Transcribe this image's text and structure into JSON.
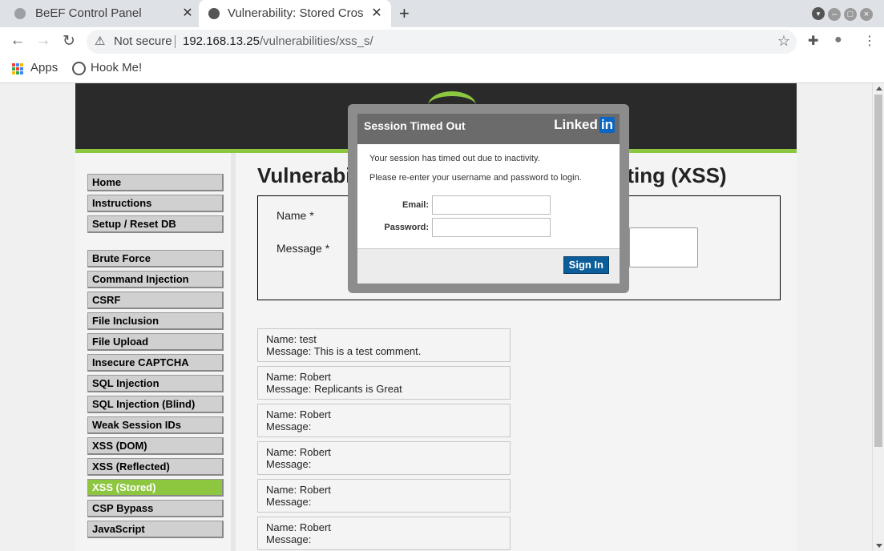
{
  "browser": {
    "tabs": [
      {
        "title": "BeEF Control Panel",
        "close": "✕"
      },
      {
        "title": "Vulnerability: Stored Cross Site Scripting (XSS) :: Damn Vulnerable Web Application (DVWA)",
        "close": "✕"
      }
    ],
    "new_tab": "+",
    "address": {
      "security": "Not secure",
      "host": "192.168.13.25",
      "path": "/vulnerabilities/xss_s/"
    },
    "bookmarks": [
      {
        "label": "Apps",
        "icon": "apps-grid-icon"
      },
      {
        "label": "Hook Me!",
        "icon": "globe-icon"
      }
    ],
    "icons": {
      "back": "←",
      "forward": "→",
      "reload": "↻",
      "warning": "⚠",
      "star": "☆",
      "extensions": "✚",
      "profile": "●",
      "menu": "⋮",
      "tab_menu": "▾"
    }
  },
  "dvwa": {
    "menu": [
      {
        "label": "Home"
      },
      {
        "label": "Instructions"
      },
      {
        "label": "Setup / Reset DB"
      },
      {
        "label": "Brute Force"
      },
      {
        "label": "Command Injection"
      },
      {
        "label": "CSRF"
      },
      {
        "label": "File Inclusion"
      },
      {
        "label": "File Upload"
      },
      {
        "label": "Insecure CAPTCHA"
      },
      {
        "label": "SQL Injection"
      },
      {
        "label": "SQL Injection (Blind)"
      },
      {
        "label": "Weak Session IDs"
      },
      {
        "label": "XSS (DOM)"
      },
      {
        "label": "XSS (Reflected)"
      },
      {
        "label": "XSS (Stored)",
        "active": true
      },
      {
        "label": "CSP Bypass"
      },
      {
        "label": "JavaScript"
      }
    ],
    "title": "Vulnerability: Stored Cross Site Scripting (XSS)",
    "form": {
      "name_label": "Name *",
      "message_label": "Message *"
    },
    "comments": [
      {
        "name": "Name: test",
        "message": "Message: This is a test comment."
      },
      {
        "name": "Name: Robert",
        "message": "Message: Replicants is Great"
      },
      {
        "name": "Name: Robert",
        "message": "Message:"
      },
      {
        "name": "Name: Robert",
        "message": "Message:"
      },
      {
        "name": "Name: Robert",
        "message": "Message:"
      },
      {
        "name": "Name: Robert",
        "message": "Message:"
      }
    ]
  },
  "modal": {
    "title": "Session Timed Out",
    "brand": "Linked",
    "brand_badge": "in",
    "msg1": "Your session has timed out due to inactivity.",
    "msg2": "Please re-enter your username and password to login.",
    "email_label": "Email:",
    "email_value": "",
    "password_label": "Password:",
    "password_value": "",
    "signin": "Sign In"
  },
  "colors": {
    "dvwa_green": "#8dc63f",
    "linkedin_blue": "#0a66c2",
    "signin_blue": "#0b5e99"
  }
}
